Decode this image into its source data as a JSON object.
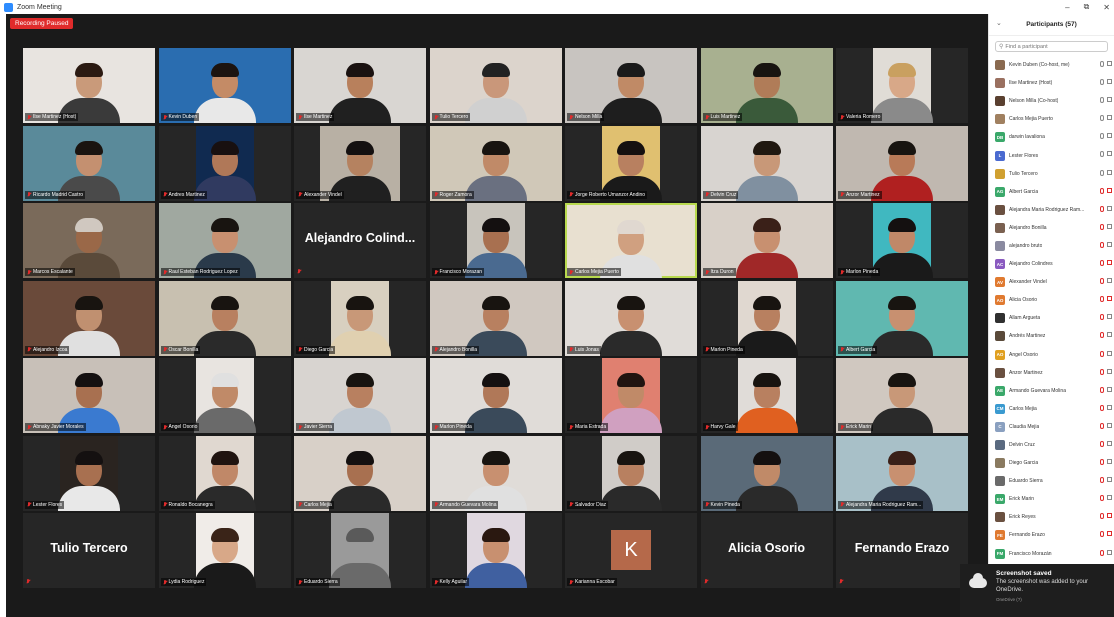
{
  "window": {
    "title": "Zoom Meeting"
  },
  "recording": {
    "badge": "Recording Paused"
  },
  "gallery": {
    "tiles": [
      {
        "name": "Ilse Martinez (Host)",
        "bg": "#e8e4e0",
        "skin": "#c99a7a",
        "hair": "#2b1a12",
        "shirt": "#3a3a3a",
        "fit": "full"
      },
      {
        "name": "Kevin Duben",
        "bg": "#2a6db0",
        "skin": "#c48b66",
        "hair": "#1c1410",
        "shirt": "#e8e8e8",
        "fit": "full"
      },
      {
        "name": "Ilse Martinez",
        "bg": "#d9d6d2",
        "skin": "#b8805c",
        "hair": "#1a1210",
        "shirt": "#202020",
        "fit": "full"
      },
      {
        "name": "Tulio Tercero",
        "bg": "#dcd4cc",
        "skin": "#c9977a",
        "hair": "#222",
        "shirt": "#d0d0d0",
        "fit": "full"
      },
      {
        "name": "Nelson Milla",
        "bg": "#c8c4c0",
        "skin": "#c08a66",
        "hair": "#1a1a1a",
        "shirt": "#1e1e1e",
        "fit": "full"
      },
      {
        "name": "Luis Martinez",
        "bg": "#a8b090",
        "skin": "#b07c58",
        "hair": "#181410",
        "shirt": "#3a5a3a",
        "fit": "full"
      },
      {
        "name": "Valeria Romero",
        "bg": "#e0dcd6",
        "skin": "#d8a888",
        "hair": "#c9a060",
        "shirt": "#8a8a8a",
        "fit": "narrow"
      },
      {
        "name": "Ricardo Madrid Castro",
        "bg": "#5a8a9a",
        "skin": "#c49070",
        "hair": "#1a1410",
        "shirt": "#4a4a4a",
        "fit": "full"
      },
      {
        "name": "Andres Martinez",
        "bg": "#102a50",
        "skin": "#b07858",
        "hair": "#181010",
        "shirt": "#303a60",
        "fit": "narrow"
      },
      {
        "name": "Alexander Vindel",
        "bg": "#b8b0a4",
        "skin": "#b58260",
        "hair": "#141010",
        "shirt": "#202020",
        "fit": "medium"
      },
      {
        "name": "Roger Zamora",
        "bg": "#d0c8b8",
        "skin": "#c08a68",
        "hair": "#181410",
        "shirt": "#6a7080",
        "fit": "full"
      },
      {
        "name": "Jorge Roberto Umanzor Andino",
        "bg": "#e0c070",
        "skin": "#b88060",
        "hair": "#151010",
        "shirt": "#1a1a1a",
        "fit": "narrow"
      },
      {
        "name": "Delvin Cruz",
        "bg": "#d8d4d0",
        "skin": "#c89878",
        "hair": "#201810",
        "shirt": "#8090a0",
        "fit": "full"
      },
      {
        "name": "Anzor Martinez",
        "bg": "#c0b8b0",
        "skin": "#b87a58",
        "hair": "#181410",
        "shirt": "#b02020",
        "fit": "full"
      },
      {
        "name": "Marcos Escalante",
        "bg": "#7a6a5a",
        "skin": "#9a6848",
        "hair": "#d0c8c0",
        "shirt": "#5a4a3a",
        "fit": "full"
      },
      {
        "name": "Raul Esteban Rodriguez Lopez",
        "bg": "#a0a8a0",
        "skin": "#c89070",
        "hair": "#181410",
        "shirt": "#2a3a4a",
        "fit": "full"
      },
      {
        "name": "",
        "big": "Alejandro  Colind...",
        "fit": "none"
      },
      {
        "name": "Francisco Morazan",
        "bg": "#c8c4bc",
        "skin": "#a87050",
        "hair": "#141010",
        "shirt": "#4a6a90",
        "fit": "narrow"
      },
      {
        "name": "Carlos Mejia Puerto",
        "bg": "#e8e0d0",
        "skin": "#d0a080",
        "hair": "#e0d8d0",
        "shirt": "#e0e0e0",
        "fit": "full",
        "active": true
      },
      {
        "name": "Itza Duron",
        "bg": "#d8d0c8",
        "skin": "#c89070",
        "hair": "#3a2018",
        "shirt": "#a02828",
        "fit": "full"
      },
      {
        "name": "Marlon Pineda",
        "bg": "#40b8c0",
        "skin": "#c08868",
        "hair": "#141010",
        "shirt": "#1a1a1a",
        "fit": "narrow"
      },
      {
        "name": "Alejandro Izcoa",
        "bg": "#6a4a3a",
        "skin": "#c09070",
        "hair": "#181410",
        "shirt": "#e0e0e0",
        "fit": "full"
      },
      {
        "name": "Oscar Bonilla",
        "bg": "#c8c0b0",
        "skin": "#b88060",
        "hair": "#181410",
        "shirt": "#2a2a2a",
        "fit": "full"
      },
      {
        "name": "Diego Garcia",
        "bg": "#d8d0c0",
        "skin": "#c89878",
        "hair": "#181410",
        "shirt": "#e0d0b0",
        "fit": "narrow"
      },
      {
        "name": "Alejandro Bonilla",
        "bg": "#d0c8c0",
        "skin": "#b88060",
        "hair": "#181410",
        "shirt": "#3a4a5a",
        "fit": "full"
      },
      {
        "name": "Luis Jonas",
        "bg": "#e0dcd8",
        "skin": "#c89070",
        "hair": "#181410",
        "shirt": "#2a2a2a",
        "fit": "full"
      },
      {
        "name": "Marlon Pineda",
        "bg": "#e0d8d0",
        "skin": "#b88060",
        "hair": "#181410",
        "shirt": "#1a1a1a",
        "fit": "narrow"
      },
      {
        "name": "Albert Garcia",
        "bg": "#60b8b0",
        "skin": "#c89070",
        "hair": "#181410",
        "shirt": "#2a2a2a",
        "fit": "full"
      },
      {
        "name": "Abnaky Javier Morales",
        "bg": "#c8c0b8",
        "skin": "#a87050",
        "hair": "#141010",
        "shirt": "#3a7ad0",
        "fit": "full"
      },
      {
        "name": "Angel Osorio",
        "bg": "#e8e4e0",
        "skin": "#c08a68",
        "hair": "#e0e0e0",
        "shirt": "#6a6a6a",
        "fit": "narrow"
      },
      {
        "name": "Javier Sierra",
        "bg": "#d8d4d0",
        "skin": "#b88060",
        "hair": "#181410",
        "shirt": "#c0c8d0",
        "fit": "full"
      },
      {
        "name": "Marlon Pineda",
        "bg": "#e0dcd8",
        "skin": "#b07858",
        "hair": "#141010",
        "shirt": "#3a4a5a",
        "fit": "full"
      },
      {
        "name": "Maria Estrada",
        "bg": "#e08070",
        "skin": "#c08a68",
        "hair": "#201410",
        "shirt": "#d0a0c0",
        "fit": "narrow"
      },
      {
        "name": "Harvy Gale",
        "bg": "#e0dcd8",
        "skin": "#b88060",
        "hair": "#181410",
        "shirt": "#e06020",
        "fit": "narrow"
      },
      {
        "name": "Erick Marin",
        "bg": "#d0c8c0",
        "skin": "#c89878",
        "hair": "#181410",
        "shirt": "#2a2a2a",
        "fit": "full"
      },
      {
        "name": "Lester Flores",
        "bg": "#2a2420",
        "skin": "#a87050",
        "hair": "#141010",
        "shirt": "#e8e8e8",
        "fit": "narrow"
      },
      {
        "name": "Ronaldo Bocanegra",
        "bg": "#e0d8d0",
        "skin": "#c08868",
        "hair": "#201410",
        "shirt": "#2a2a2a",
        "fit": "narrow"
      },
      {
        "name": "Carlos Mejia",
        "bg": "#d8d0c8",
        "skin": "#a87050",
        "hair": "#141010",
        "shirt": "#2a2a2a",
        "fit": "full"
      },
      {
        "name": "Armando Guevara Molina",
        "bg": "#e0dcd8",
        "skin": "#c89070",
        "hair": "#181410",
        "shirt": "#e0e0e0",
        "fit": "full"
      },
      {
        "name": "Salvador Diaz",
        "bg": "#d0ccc8",
        "skin": "#b88060",
        "hair": "#181410",
        "shirt": "#2a2a2a",
        "fit": "narrow"
      },
      {
        "name": "Kevin Pineda",
        "bg": "#5a6a78",
        "skin": "#c08a68",
        "hair": "#141010",
        "shirt": "#2a2a2a",
        "fit": "full"
      },
      {
        "name": "Alejandra Maria Rodriguez Ram...",
        "bg": "#a8c0c8",
        "skin": "#c89070",
        "hair": "#3a2018",
        "shirt": "#303a4a",
        "fit": "full"
      },
      {
        "name": "",
        "big": "Tulio Tercero",
        "fit": "none"
      },
      {
        "name": "Lydia Rodriguez",
        "bg": "#f0ece8",
        "skin": "#d8a888",
        "hair": "#3a2418",
        "shirt": "#1a1a1a",
        "fit": "narrow"
      },
      {
        "name": "Eduardo Sierra",
        "bg": "#9a9a9a",
        "skin": "#9a9a9a",
        "hair": "#5a5a5a",
        "shirt": "#6a6a6a",
        "fit": "narrow"
      },
      {
        "name": "Kelly Aguilar",
        "bg": "#e0d8e0",
        "skin": "#c89070",
        "hair": "#2a1810",
        "shirt": "#4060a0",
        "fit": "narrow"
      },
      {
        "name": "Karianna Escobar",
        "big_letter": "K",
        "fit": "letter"
      },
      {
        "name": "",
        "big": "Alicia Osorio",
        "fit": "none"
      },
      {
        "name": "",
        "big": "Fernando Erazo",
        "fit": "none"
      }
    ]
  },
  "participants": {
    "title": "Participants (57)",
    "search_placeholder": "Find a participant",
    "list": [
      {
        "name": "Kevin Duben (Co-host, me)",
        "color": "#8a6a50",
        "initials": "",
        "mic_off": false,
        "cam_off": false
      },
      {
        "name": "Ilse Martinez (Host)",
        "color": "#9a7060",
        "initials": "",
        "mic_off": false,
        "cam_off": false
      },
      {
        "name": "Nelson Milla (Co-host)",
        "color": "#5a4030",
        "initials": "",
        "mic_off": false,
        "cam_off": false
      },
      {
        "name": "Carlos Mejia Puerto",
        "color": "#a08060",
        "initials": "",
        "mic_off": false,
        "cam_off": false
      },
      {
        "name": "darwin lavaliona",
        "color": "#3aa86a",
        "initials": "DB",
        "mic_off": false,
        "cam_off": false
      },
      {
        "name": "Lester Flores",
        "color": "#4a6ad0",
        "initials": "L",
        "mic_off": false,
        "cam_off": false
      },
      {
        "name": "Tulio Tercero",
        "color": "#d0a030",
        "initials": "",
        "mic_off": false,
        "cam_off": false
      },
      {
        "name": "Albert Garcia",
        "color": "#3aa86a",
        "initials": "AG",
        "mic_off": true,
        "cam_off": true
      },
      {
        "name": "Alejandra Maria Rodriguez Ram...",
        "color": "#6a5040",
        "initials": "",
        "mic_off": true,
        "cam_off": false
      },
      {
        "name": "Alejandro Bonilla",
        "color": "#7a6050",
        "initials": "",
        "mic_off": true,
        "cam_off": false
      },
      {
        "name": "alejandro bruto",
        "color": "#8a8aa0",
        "initials": "",
        "mic_off": true,
        "cam_off": false
      },
      {
        "name": "Alejandro Colindres",
        "color": "#8a5ac0",
        "initials": "AC",
        "mic_off": true,
        "cam_off": true
      },
      {
        "name": "Alexander Vindel",
        "color": "#e07a30",
        "initials": "AV",
        "mic_off": true,
        "cam_off": false
      },
      {
        "name": "Alicia Osorio",
        "color": "#e07a30",
        "initials": "AO",
        "mic_off": true,
        "cam_off": true
      },
      {
        "name": "Allam Argueta",
        "color": "#303030",
        "initials": "",
        "mic_off": true,
        "cam_off": false
      },
      {
        "name": "Andrés Martinez",
        "color": "#5a4a3a",
        "initials": "",
        "mic_off": true,
        "cam_off": false
      },
      {
        "name": "Angel Osorio",
        "color": "#e0a020",
        "initials": "AO",
        "mic_off": true,
        "cam_off": false
      },
      {
        "name": "Anzor Martinez",
        "color": "#6a5040",
        "initials": "",
        "mic_off": true,
        "cam_off": false
      },
      {
        "name": "Armando Guevara Molina",
        "color": "#3aa86a",
        "initials": "AE",
        "mic_off": true,
        "cam_off": false
      },
      {
        "name": "Carlos Mejia",
        "color": "#3a9ad0",
        "initials": "CM",
        "mic_off": true,
        "cam_off": false
      },
      {
        "name": "Claudia Mejia",
        "color": "#8aa0c0",
        "initials": "C",
        "mic_off": true,
        "cam_off": false
      },
      {
        "name": "Delvin Cruz",
        "color": "#5a6a80",
        "initials": "",
        "mic_off": true,
        "cam_off": false
      },
      {
        "name": "Diego Garcia",
        "color": "#8a7a60",
        "initials": "",
        "mic_off": true,
        "cam_off": false
      },
      {
        "name": "Eduardo Sierra",
        "color": "#6a6a6a",
        "initials": "",
        "mic_off": true,
        "cam_off": false
      },
      {
        "name": "Erick Marin",
        "color": "#3aa86a",
        "initials": "EM",
        "mic_off": true,
        "cam_off": false
      },
      {
        "name": "Erick Reyes",
        "color": "#6a5040",
        "initials": "",
        "mic_off": true,
        "cam_off": true
      },
      {
        "name": "Fernando Erazo",
        "color": "#e07a30",
        "initials": "FE",
        "mic_off": true,
        "cam_off": true
      },
      {
        "name": "Francisco Morazán",
        "color": "#3aa86a",
        "initials": "FM",
        "mic_off": true,
        "cam_off": false
      }
    ]
  },
  "toast": {
    "title": "Screenshot saved",
    "message": "The screenshot was added to your OneDrive.",
    "source": "OneDrive (?)"
  }
}
